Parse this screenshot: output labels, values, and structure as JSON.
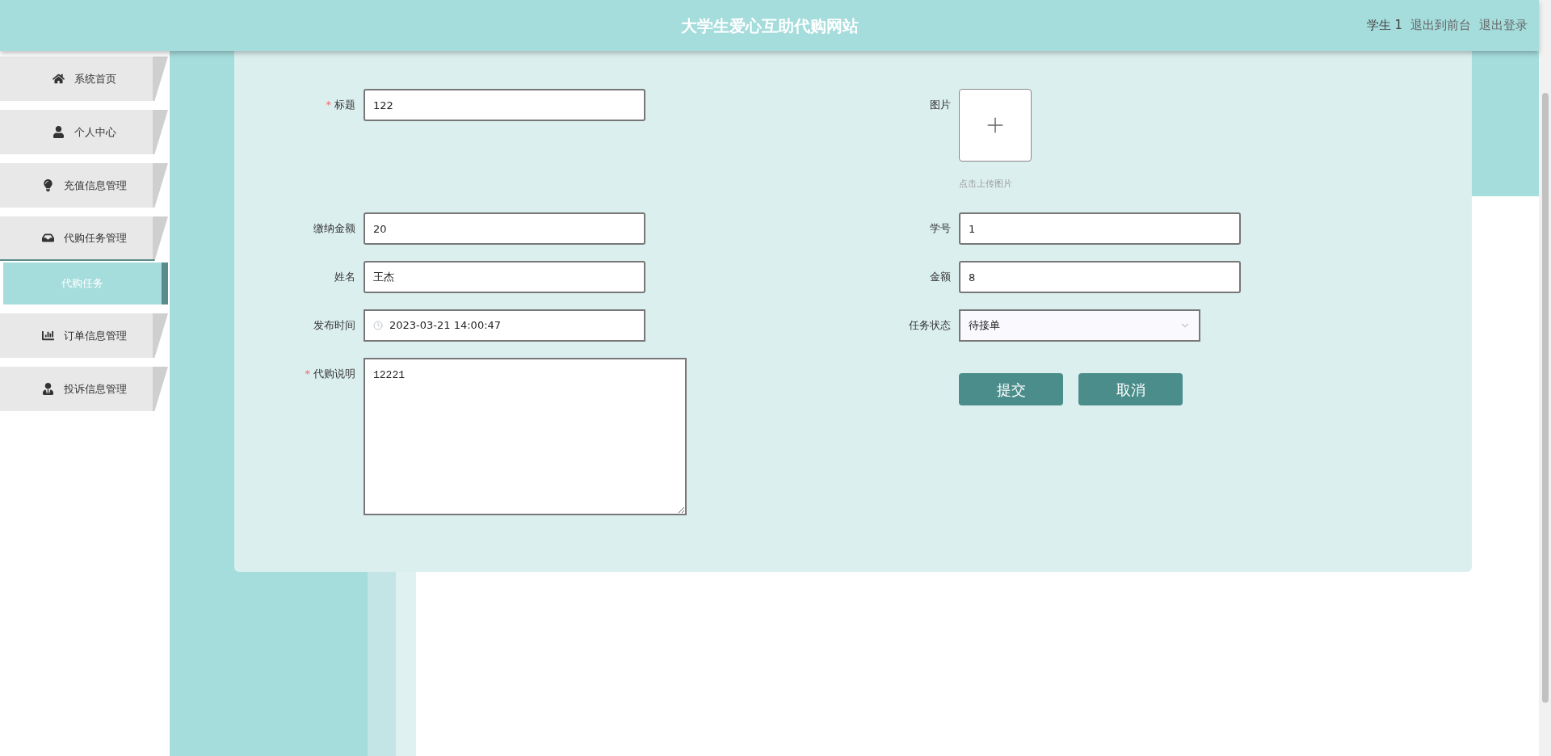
{
  "header": {
    "title": "大学生爱心互助代购网站",
    "user": "学生 1",
    "links": [
      "退出到前台",
      "退出登录"
    ]
  },
  "sidebar": {
    "items": [
      {
        "label": "系统首页",
        "selected": false
      },
      {
        "label": "个人中心",
        "selected": false
      },
      {
        "label": "充值信息管理",
        "selected": false
      },
      {
        "label": "代购任务管理",
        "selected": false,
        "expanded": true,
        "children": [
          {
            "label": "代购任务",
            "selected": true
          }
        ]
      },
      {
        "label": "订单信息管理",
        "selected": false
      },
      {
        "label": "投诉信息管理",
        "selected": false
      }
    ]
  },
  "form": {
    "left_fields": [
      {
        "kind": "text",
        "label": "标题",
        "required_mark": "*",
        "value": "122"
      },
      {
        "kind": "text",
        "label": "缴纳金额",
        "value": "20"
      },
      {
        "kind": "text",
        "label": "姓名",
        "value": "王杰"
      },
      {
        "kind": "date",
        "label": "发布时间",
        "value": "2023-03-21 14:00:47"
      },
      {
        "kind": "textarea",
        "label": "代购说明",
        "required_mark": "*",
        "value": "12221"
      }
    ],
    "right_fields": [
      {
        "kind": "upload",
        "label": "图片",
        "hint": "点击上传图片"
      },
      {
        "kind": "text",
        "label": "学号",
        "value": "1"
      },
      {
        "kind": "text",
        "label": "金额",
        "value": "8"
      },
      {
        "kind": "select",
        "label": "任务状态",
        "value": "待接单"
      }
    ],
    "buttons": [
      "提交",
      "取消"
    ]
  }
}
